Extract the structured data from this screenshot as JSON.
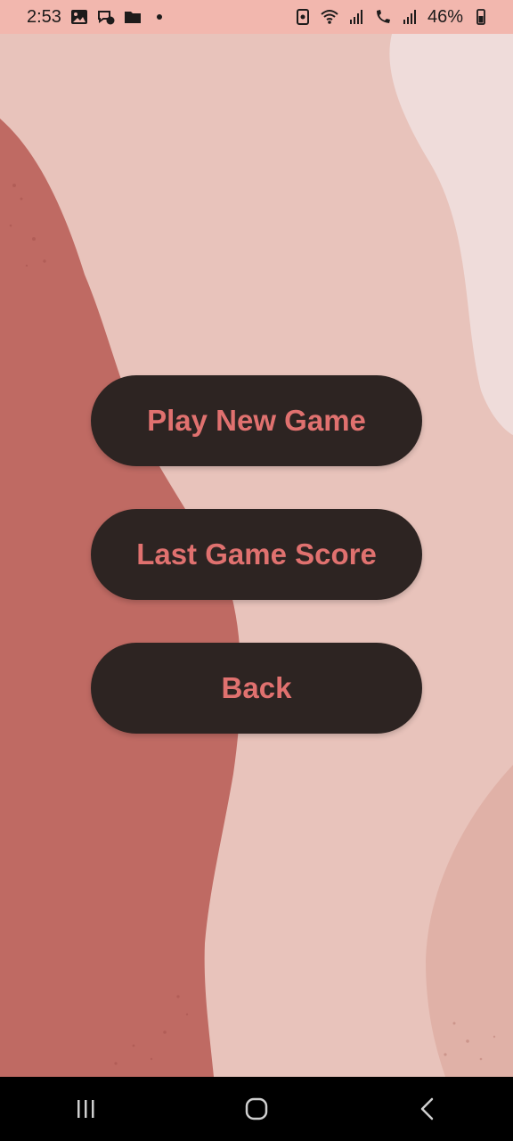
{
  "status_bar": {
    "time": "2:53",
    "battery": "46%",
    "notification_icons": [
      "gallery-icon",
      "messenger-icon",
      "folder-icon",
      "dot-icon"
    ],
    "system_icons": [
      "nfc-icon",
      "wifi-icon",
      "signal-icon",
      "wifi-call-icon",
      "signal-icon",
      "battery-icon"
    ]
  },
  "menu": {
    "buttons": [
      {
        "label": "Play New Game"
      },
      {
        "label": "Last Game Score"
      },
      {
        "label": "Back"
      }
    ]
  },
  "nav_bar": {
    "icons": [
      "recent-apps-icon",
      "home-icon",
      "back-icon"
    ]
  },
  "colors": {
    "background": "#e7c2ba",
    "button_background": "#2d2422",
    "button_text": "#e0716f",
    "status_bar": "#f2b7ae",
    "dark_blob": "#bf6a63"
  }
}
